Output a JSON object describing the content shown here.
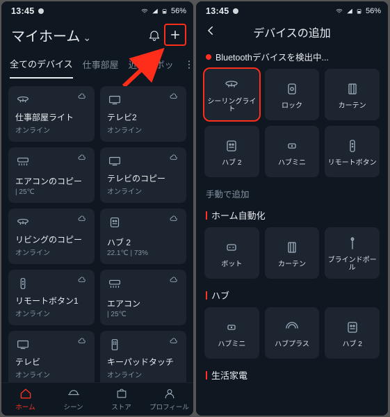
{
  "status": {
    "time": "13:45",
    "battery": "56%"
  },
  "left": {
    "header": {
      "title": "マイホーム"
    },
    "tabs": [
      "全てのデバイス",
      "仕事部屋",
      "近くのボッ"
    ],
    "devices": [
      {
        "name": "仕事部屋ライト",
        "sub": "オンライン",
        "icon": "ceilinglight"
      },
      {
        "name": "テレビ2",
        "sub": "オンライン",
        "icon": "tv"
      },
      {
        "name": "エアコンのコピー",
        "sub": "| 25℃",
        "icon": "ac"
      },
      {
        "name": "テレビのコピー",
        "sub": "オンライン",
        "icon": "tv"
      },
      {
        "name": "リビングのコピー",
        "sub": "オンライン",
        "icon": "ceilinglight"
      },
      {
        "name": "ハブ 2",
        "sub": "22.1℃ | 73%",
        "icon": "hub2"
      },
      {
        "name": "リモートボタン1",
        "sub": "オンライン",
        "icon": "remote"
      },
      {
        "name": "エアコン",
        "sub": "| 25℃",
        "icon": "ac"
      },
      {
        "name": "テレビ",
        "sub": "オンライン",
        "icon": "tv"
      },
      {
        "name": "キーパッドタッチ",
        "sub": "オンライン",
        "icon": "keypad"
      }
    ],
    "bottom": [
      "ホーム",
      "シーン",
      "ストア",
      "プロフィール"
    ]
  },
  "right": {
    "header": {
      "title": "デバイスの追加"
    },
    "scan": "Bluetoothデバイスを検出中...",
    "detected": [
      {
        "name": "シーリングライト",
        "icon": "ceilinglight",
        "highlight": true
      },
      {
        "name": "ロック",
        "icon": "lock"
      },
      {
        "name": "カーテン",
        "icon": "curtain"
      },
      {
        "name": "ハブ 2",
        "icon": "hub2"
      },
      {
        "name": "ハブミニ",
        "icon": "hubmini"
      },
      {
        "name": "リモートボタン",
        "icon": "remote"
      }
    ],
    "manual_label": "手動で追加",
    "cat1": "ホーム自動化",
    "group1": [
      {
        "name": "ボット",
        "icon": "bot"
      },
      {
        "name": "カーテン",
        "icon": "curtain"
      },
      {
        "name": "ブラインドポール",
        "icon": "blindpole"
      }
    ],
    "cat2": "ハブ",
    "group2": [
      {
        "name": "ハブミニ",
        "icon": "hubmini"
      },
      {
        "name": "ハブプラス",
        "icon": "hubplus"
      },
      {
        "name": "ハブ 2",
        "icon": "hub2"
      }
    ],
    "cat3": "生活家電"
  }
}
